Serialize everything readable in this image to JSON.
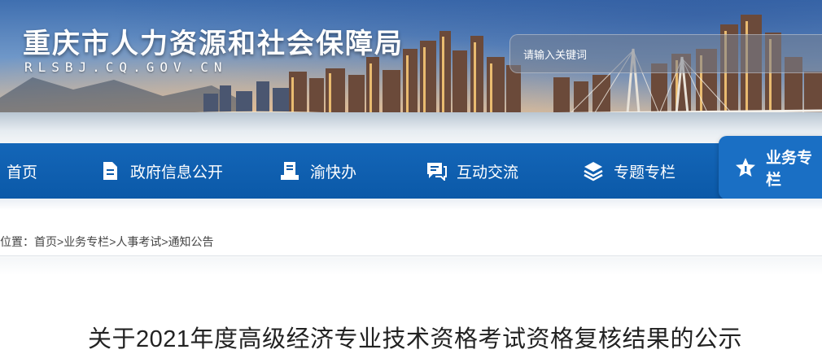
{
  "header": {
    "title": "重庆市人力资源和社会保障局",
    "domain": "RLSBJ.CQ.GOV.CN"
  },
  "search": {
    "placeholder": "请输入关键词"
  },
  "nav": {
    "items": [
      {
        "label": "首页",
        "icon": "none"
      },
      {
        "label": "政府信息公开",
        "icon": "document-icon"
      },
      {
        "label": "渝快办",
        "icon": "service-icon"
      },
      {
        "label": "互动交流",
        "icon": "chat-icon"
      },
      {
        "label": "专题专栏",
        "icon": "layers-icon"
      },
      {
        "label": "业务专栏",
        "icon": "star-icon",
        "active": true
      }
    ]
  },
  "breadcrumb": {
    "prefix": "位置：",
    "items": [
      "首页",
      "业务专栏",
      "人事考试",
      "通知公告"
    ],
    "separator": ">"
  },
  "article": {
    "title": "关于2021年度高级经济专业技术资格考试资格复核结果的公示"
  },
  "colors": {
    "nav_bg": "#0b59a8",
    "nav_active": "#1a6fc4",
    "text": "#222222"
  }
}
